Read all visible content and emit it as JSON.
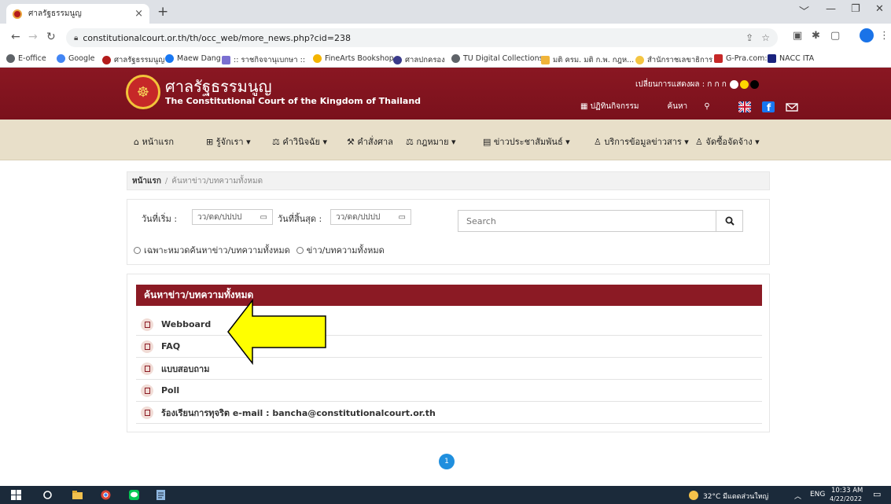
{
  "browser": {
    "tab_title": "ศาลรัฐธรรมนูญ",
    "tab_close": "×",
    "new_tab": "+",
    "url": "constitutionalcourt.or.th/th/occ_web/more_news.php?cid=238",
    "bookmarks": [
      {
        "label": "E-office",
        "color": "#5f6368"
      },
      {
        "label": "Google",
        "color": "#4285f4"
      },
      {
        "label": "ศาลรัฐธรรมนูญ",
        "color": "#b31b1b"
      },
      {
        "label": "Maew Dang",
        "color": "#1877f2"
      },
      {
        "label": ":: ราชกิจจานุเบกษา ::",
        "color": "#7a6fd1"
      },
      {
        "label": "FineArts Bookshop",
        "color": "#f4b400"
      },
      {
        "label": "ศาลปกครอง",
        "color": "#3a3a8a"
      },
      {
        "label": "TU Digital Collections",
        "color": "#5f6368"
      },
      {
        "label": "มติ ครม. มติ ก.พ. กฎห...",
        "color": "#f0b43a"
      },
      {
        "label": "สำนักราชเลขาธิการ",
        "color": "#f4c542"
      },
      {
        "label": "G-Pra.com:",
        "color": "#c62828"
      },
      {
        "label": "NACC ITA",
        "color": "#1a237e"
      }
    ]
  },
  "header": {
    "title_th": "ศาลรัฐธรรมนูญ",
    "title_en": "The Constitutional Court of the Kingdom of Thailand",
    "display_label": "เปลี่ยนการแสดงผล : ก ก ก",
    "calendar_label": "ปฏิทินกิจกรรม",
    "search_label": "ค้นหา"
  },
  "nav": [
    {
      "label": "หน้าแรก",
      "icon": "home-icon"
    },
    {
      "label": "รู้จักเรา ▾",
      "icon": "info-icon"
    },
    {
      "label": "คำวินิจฉัย ▾",
      "icon": "decision-icon"
    },
    {
      "label": "คำสั่งศาล",
      "icon": "court-order-icon"
    },
    {
      "label": "กฎหมาย ▾",
      "icon": "law-icon"
    },
    {
      "label": "ข่าวประชาสัมพันธ์ ▾",
      "icon": "news-icon"
    },
    {
      "label": "บริการข้อมูลข่าวสาร ▾",
      "icon": "service-icon"
    },
    {
      "label": "จัดซื้อจัดจ้าง ▾",
      "icon": "procurement-icon"
    }
  ],
  "breadcrumb": {
    "home": "หน้าแรก",
    "separator": "/",
    "current": "ค้นหาข่าว/บทความทั้งหมด"
  },
  "search": {
    "start_label": "วันที่เริ่ม :",
    "end_label": "วันที่สิ้นสุด :",
    "date_placeholder": "วว/ดด/ปปปป",
    "placeholder": "Search",
    "radio_category": "เฉพาะหมวดค้นหาข่าว/บทความทั้งหมด",
    "radio_all": "ข่าว/บทความทั้งหมด"
  },
  "results": {
    "heading": "ค้นหาข่าว/บทความทั้งหมด",
    "items": [
      "Webboard",
      "FAQ",
      "แบบสอบถาม",
      "Poll",
      "ร้องเรียนการทุจริต e-mail : bancha@constitutionalcourt.or.th"
    ]
  },
  "pagination": {
    "current": "1"
  },
  "colors": {
    "brand": "#8b1a24",
    "nav_bg": "#e8dfc9",
    "page_accent": "#1f8fde",
    "arrow": "#ffff00"
  },
  "taskbar": {
    "weather": "32°C มีแดดส่วนใหญ่",
    "lang": "ENG",
    "time": "10:33 AM",
    "date": "4/22/2022"
  }
}
